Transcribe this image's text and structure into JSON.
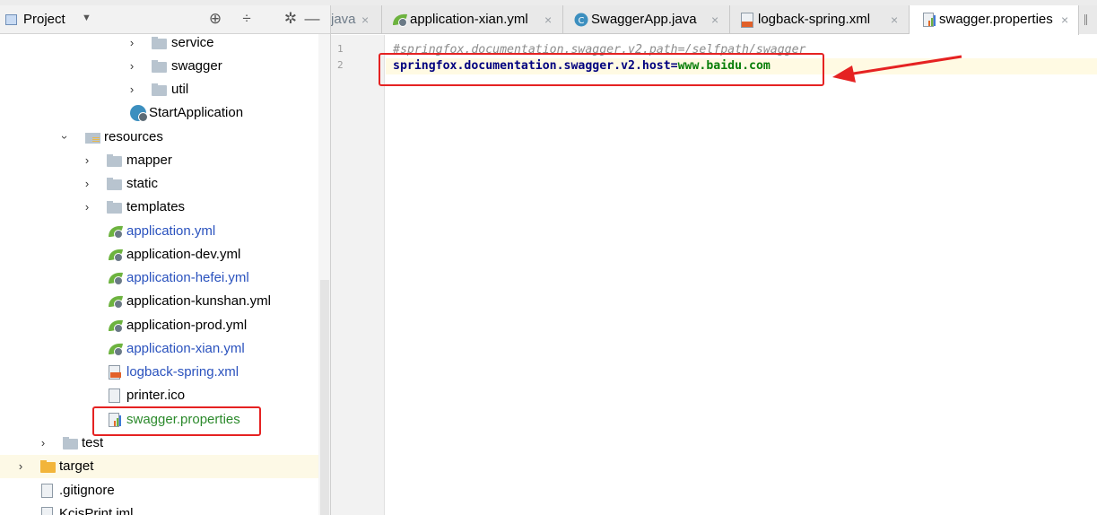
{
  "project_panel": {
    "title": "Project",
    "tree": [
      {
        "label": "service",
        "icon": "folder-icon",
        "expanded": false,
        "color": "black"
      },
      {
        "label": "swagger",
        "icon": "folder-icon",
        "expanded": false,
        "color": "black"
      },
      {
        "label": "util",
        "icon": "folder-icon",
        "expanded": false,
        "color": "black"
      },
      {
        "label": "StartApplication",
        "icon": "spring-boot-class-icon",
        "color": "black"
      },
      {
        "label": "resources",
        "icon": "resources-folder-icon",
        "expanded": true,
        "color": "black"
      },
      {
        "label": "mapper",
        "icon": "folder-icon",
        "expanded": false,
        "color": "black"
      },
      {
        "label": "static",
        "icon": "folder-icon",
        "expanded": false,
        "color": "black"
      },
      {
        "label": "templates",
        "icon": "folder-icon",
        "expanded": false,
        "color": "black"
      },
      {
        "label": "application.yml",
        "icon": "spring-yml-icon",
        "color": "blue"
      },
      {
        "label": "application-dev.yml",
        "icon": "spring-yml-icon",
        "color": "black"
      },
      {
        "label": "application-hefei.yml",
        "icon": "spring-yml-icon",
        "color": "blue"
      },
      {
        "label": "application-kunshan.yml",
        "icon": "spring-yml-icon",
        "color": "black"
      },
      {
        "label": "application-prod.yml",
        "icon": "spring-yml-icon",
        "color": "black"
      },
      {
        "label": "application-xian.yml",
        "icon": "spring-yml-icon",
        "color": "blue"
      },
      {
        "label": "logback-spring.xml",
        "icon": "xml-file-icon",
        "color": "blue"
      },
      {
        "label": "printer.ico",
        "icon": "file-icon",
        "color": "black"
      },
      {
        "label": "swagger.properties",
        "icon": "properties-file-icon",
        "color": "green"
      },
      {
        "label": "test",
        "icon": "folder-icon",
        "expanded": false,
        "color": "black"
      },
      {
        "label": "target",
        "icon": "excluded-folder-icon",
        "expanded": false,
        "color": "black"
      },
      {
        "label": ".gitignore",
        "icon": "file-icon",
        "color": "black"
      },
      {
        "label": "KcisPrint.iml",
        "icon": "iml-file-icon",
        "color": "black"
      }
    ]
  },
  "editor": {
    "tabs": [
      {
        "label": "java",
        "icon": "",
        "active": false
      },
      {
        "label": "application-xian.yml",
        "icon": "spring-yml-icon",
        "active": false
      },
      {
        "label": "SwaggerApp.java",
        "icon": "java-class-icon",
        "active": false
      },
      {
        "label": "logback-spring.xml",
        "icon": "xml-file-icon",
        "active": false
      },
      {
        "label": "swagger.properties",
        "icon": "properties-file-icon",
        "active": true
      }
    ],
    "close_glyph": "×",
    "lines": [
      {
        "number": "1",
        "comment": "#springfox.documentation.swagger.v2.path=/selfpath/swagger"
      },
      {
        "number": "2",
        "key": "springfox.documentation.swagger.v2.host",
        "eq": "=",
        "value": "www.baidu.com"
      }
    ]
  },
  "colors": {
    "annotation_red": "#e52222",
    "tree_blue": "#2a52be",
    "tree_green": "#2c8a2c",
    "selected_row": "#fdf9e6"
  }
}
